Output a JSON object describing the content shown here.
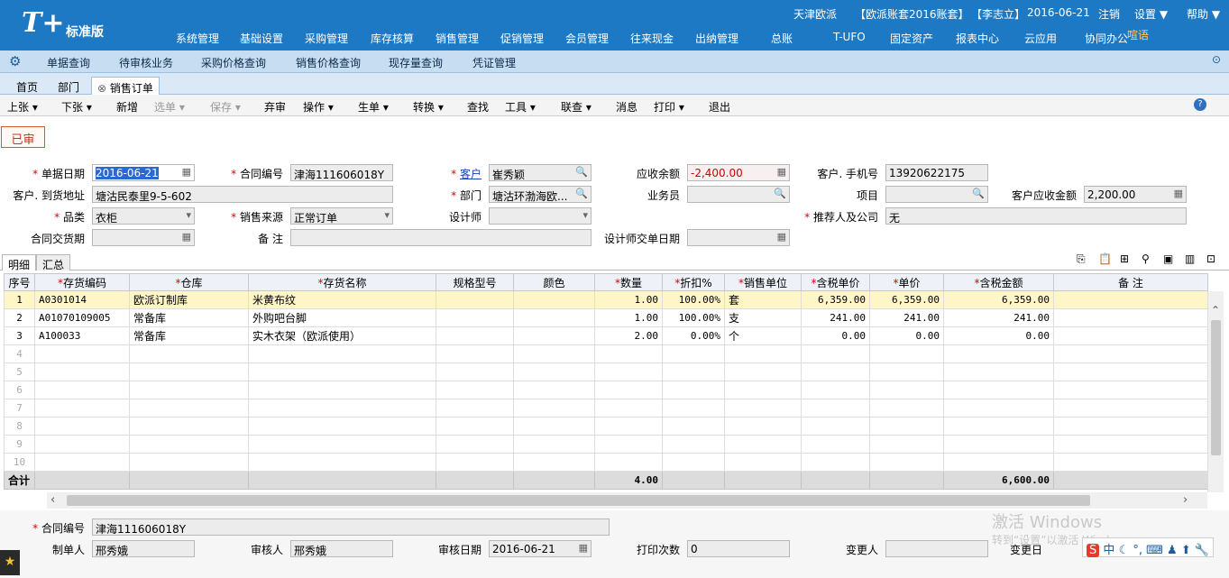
{
  "header": {
    "logo_letter": "T+",
    "edition": "标准版",
    "company": "天津欧派",
    "account_set": "【欧派账套2016账套】",
    "user": "【李志立】",
    "date": "2016-06-21",
    "logout": "注销",
    "settings": "设置",
    "help": "帮助",
    "notify": "喧语"
  },
  "menu": [
    "系统管理",
    "基础设置",
    "采购管理",
    "库存核算",
    "销售管理",
    "促销管理",
    "会员管理",
    "往来现金",
    "出纳管理",
    "总账",
    "T-UFO",
    "固定资产",
    "报表中心",
    "云应用",
    "协同办公"
  ],
  "subnav": [
    "单据查询",
    "待审核业务",
    "采购价格查询",
    "销售价格查询",
    "现存量查询",
    "凭证管理"
  ],
  "tabs": [
    "首页",
    "部门",
    "销售订单"
  ],
  "toolbar": [
    {
      "label": "上张",
      "drop": true,
      "enabled": true
    },
    {
      "label": "下张",
      "drop": true,
      "enabled": true
    },
    {
      "label": "新增",
      "drop": false,
      "enabled": true
    },
    {
      "label": "选单",
      "drop": true,
      "enabled": false
    },
    {
      "label": "保存",
      "drop": true,
      "enabled": false
    },
    {
      "label": "弃审",
      "drop": false,
      "enabled": true
    },
    {
      "label": "操作",
      "drop": true,
      "enabled": true
    },
    {
      "label": "生单",
      "drop": true,
      "enabled": true
    },
    {
      "label": "转换",
      "drop": true,
      "enabled": true
    },
    {
      "label": "查找",
      "drop": false,
      "enabled": true
    },
    {
      "label": "工具",
      "drop": true,
      "enabled": true
    },
    {
      "label": "联查",
      "drop": true,
      "enabled": true
    },
    {
      "label": "消息",
      "drop": false,
      "enabled": true
    },
    {
      "label": "打印",
      "drop": true,
      "enabled": true
    },
    {
      "label": "退出",
      "drop": false,
      "enabled": true
    }
  ],
  "status": "已审",
  "form": {
    "doc_date_label": "单据日期",
    "doc_date": "2016-06-21",
    "contract_no_label": "合同编号",
    "contract_no": "津海111606018Y",
    "customer_label": "客户",
    "customer": "崔秀颖",
    "receivable_label": "应收余额",
    "receivable": "-2,400.00",
    "phone_label": "客户. 手机号",
    "phone": "13920622175",
    "address_label": "客户. 到货地址",
    "address": "塘沽民泰里9-5-602",
    "dept_label": "部门",
    "dept": "塘沽环渤海欧...",
    "salesman_label": "业务员",
    "salesman": "",
    "project_label": "项目",
    "project": "",
    "cust_recv_label": "客户应收金额",
    "cust_recv": "2,200.00",
    "category_label": "品类",
    "category": "衣柜",
    "source_label": "销售来源",
    "source": "正常订单",
    "designer_label": "设计师",
    "designer": "",
    "referrer_label": "推荐人及公司",
    "referrer": "无",
    "delivery_label": "合同交货期",
    "delivery": "",
    "remark_label": "备 注",
    "remark": "",
    "designer_date_label": "设计师交单日期",
    "designer_date": ""
  },
  "detail_tabs": [
    "明细",
    "汇总"
  ],
  "grid": {
    "columns": [
      "序号",
      "存货编码",
      "仓库",
      "存货名称",
      "规格型号",
      "颜色",
      "数量",
      "折扣%",
      "销售单位",
      "含税单价",
      "单价",
      "含税金额",
      "备 注"
    ],
    "required": [
      false,
      true,
      true,
      true,
      false,
      false,
      true,
      true,
      true,
      true,
      true,
      true,
      false
    ],
    "rows": [
      [
        "1",
        "A0301014",
        "欧派订制库",
        "米黄布纹",
        "",
        "",
        "1.00",
        "100.00%",
        "套",
        "6,359.00",
        "6,359.00",
        "6,359.00",
        ""
      ],
      [
        "2",
        "A01070109005",
        "常备库",
        "外购吧台脚",
        "",
        "",
        "1.00",
        "100.00%",
        "支",
        "241.00",
        "241.00",
        "241.00",
        ""
      ],
      [
        "3",
        "A100033",
        "常备库",
        "实木衣架（欧派使用）",
        "",
        "",
        "2.00",
        "0.00%",
        "个",
        "0.00",
        "0.00",
        "0.00",
        ""
      ]
    ],
    "empty_rows": [
      "4",
      "5",
      "6",
      "7",
      "8",
      "9",
      "10"
    ],
    "total_label": "合计",
    "total_qty": "4.00",
    "total_amount": "6,600.00"
  },
  "footer": {
    "contract_no_label": "合同编号",
    "contract_no": "津海111606018Y",
    "maker_label": "制单人",
    "maker": "邢秀娥",
    "auditor_label": "审核人",
    "auditor": "邢秀娥",
    "audit_date_label": "审核日期",
    "audit_date": "2016-06-21",
    "print_count_label": "打印次数",
    "print_count": "0",
    "changer_label": "变更人",
    "changer": "",
    "change_date_label": "变更日"
  },
  "watermark": {
    "line1": "激活 Windows",
    "line2": "转到“设置”以激活 Windows。"
  },
  "tray_text": "中"
}
